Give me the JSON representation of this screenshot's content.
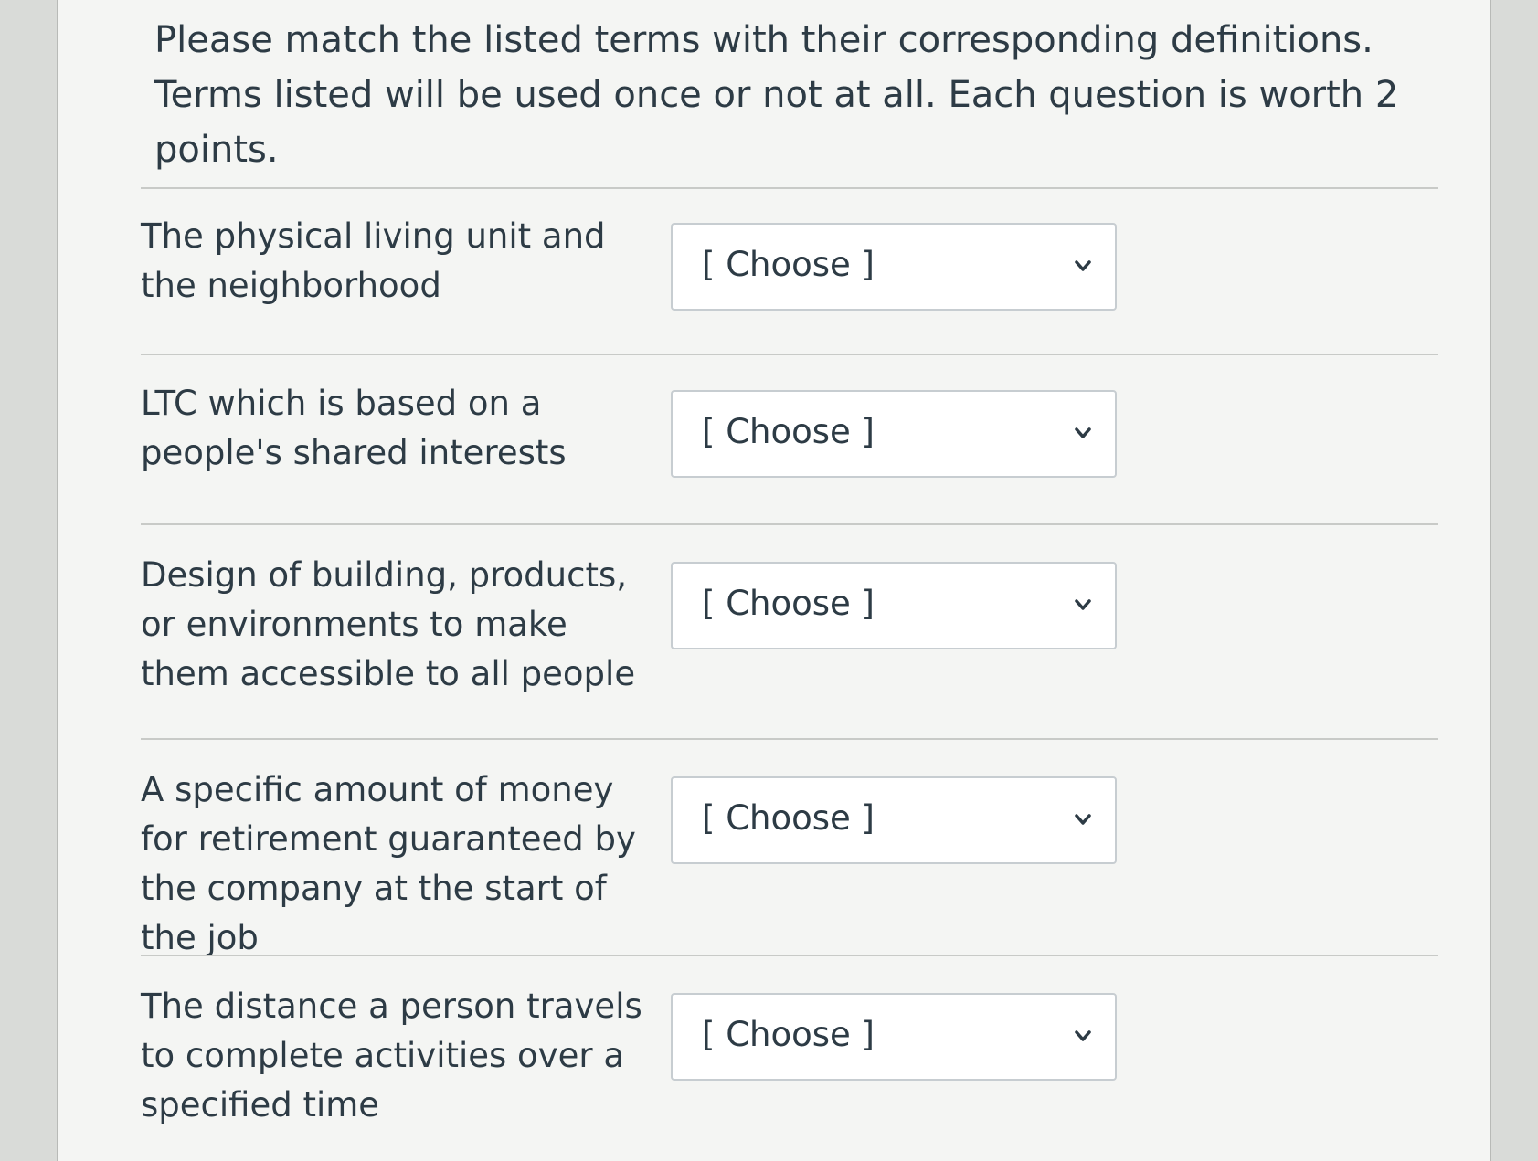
{
  "instructions": "Please match the listed terms with their corresponding definitions. Terms listed will be used once or not at all.  Each question is worth 2 points.",
  "questions": [
    {
      "prompt": "The physical living unit and the neighborhood",
      "selected": "[ Choose ]"
    },
    {
      "prompt": "LTC which is based on a people's shared interests",
      "selected": "[ Choose ]"
    },
    {
      "prompt": "Design of building, products, or environments to make them accessible to all people",
      "selected": "[ Choose ]"
    },
    {
      "prompt": "A specific amount of money for retirement guaranteed by the company at the start of the job",
      "selected": "[ Choose ]"
    },
    {
      "prompt": "The distance a person travels to complete activities over a specified time",
      "selected": "[ Choose ]"
    }
  ],
  "icons": {
    "dropdown": "chevron-down-icon"
  },
  "colors": {
    "text": "#2d3b45",
    "border": "#c7cdd1",
    "background": "#f4f5f3"
  }
}
